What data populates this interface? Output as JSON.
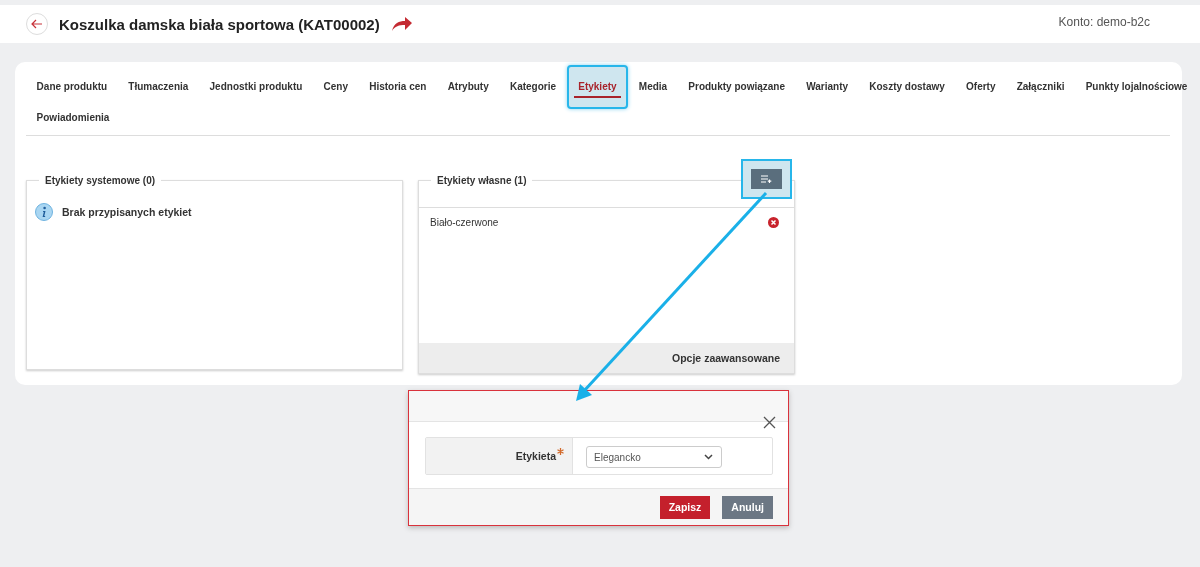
{
  "header": {
    "title": "Koszulka damska biała sportowa (KAT00002)",
    "account": "Konto: demo-b2c"
  },
  "tab_rows": [
    [
      {
        "label": "Dane produktu",
        "selected": false
      },
      {
        "label": "Tłumaczenia",
        "selected": false
      },
      {
        "label": "Jednostki produktu",
        "selected": false
      },
      {
        "label": "Ceny",
        "selected": false
      },
      {
        "label": "Historia cen",
        "selected": false
      },
      {
        "label": "Atrybuty",
        "selected": false
      },
      {
        "label": "Kategorie",
        "selected": false
      },
      {
        "label": "Etykiety",
        "selected": true
      },
      {
        "label": "Media",
        "selected": false
      },
      {
        "label": "Produkty powiązane",
        "selected": false
      },
      {
        "label": "Warianty",
        "selected": false
      },
      {
        "label": "Koszty dostawy",
        "selected": false
      },
      {
        "label": "Oferty",
        "selected": false
      },
      {
        "label": "Załączniki",
        "selected": false
      },
      {
        "label": "Punkty lojalnościowe",
        "selected": false
      }
    ],
    [
      {
        "label": "Powiadomienia",
        "selected": false
      }
    ]
  ],
  "system_labels": {
    "title": "Etykiety systemowe (0)",
    "empty_message": "Brak przypisanych etykiet"
  },
  "own_labels": {
    "title": "Etykiety własne (1)",
    "items": [
      {
        "name": "Biało-czerwone"
      }
    ],
    "footer": "Opcje zaawansowane"
  },
  "modal": {
    "field_label": "Etykieta",
    "required": true,
    "value": "Elegancko",
    "buttons": [
      {
        "label": "Zapisz",
        "kind": "primary"
      },
      {
        "label": "Anuluj",
        "kind": "secondary"
      }
    ]
  }
}
